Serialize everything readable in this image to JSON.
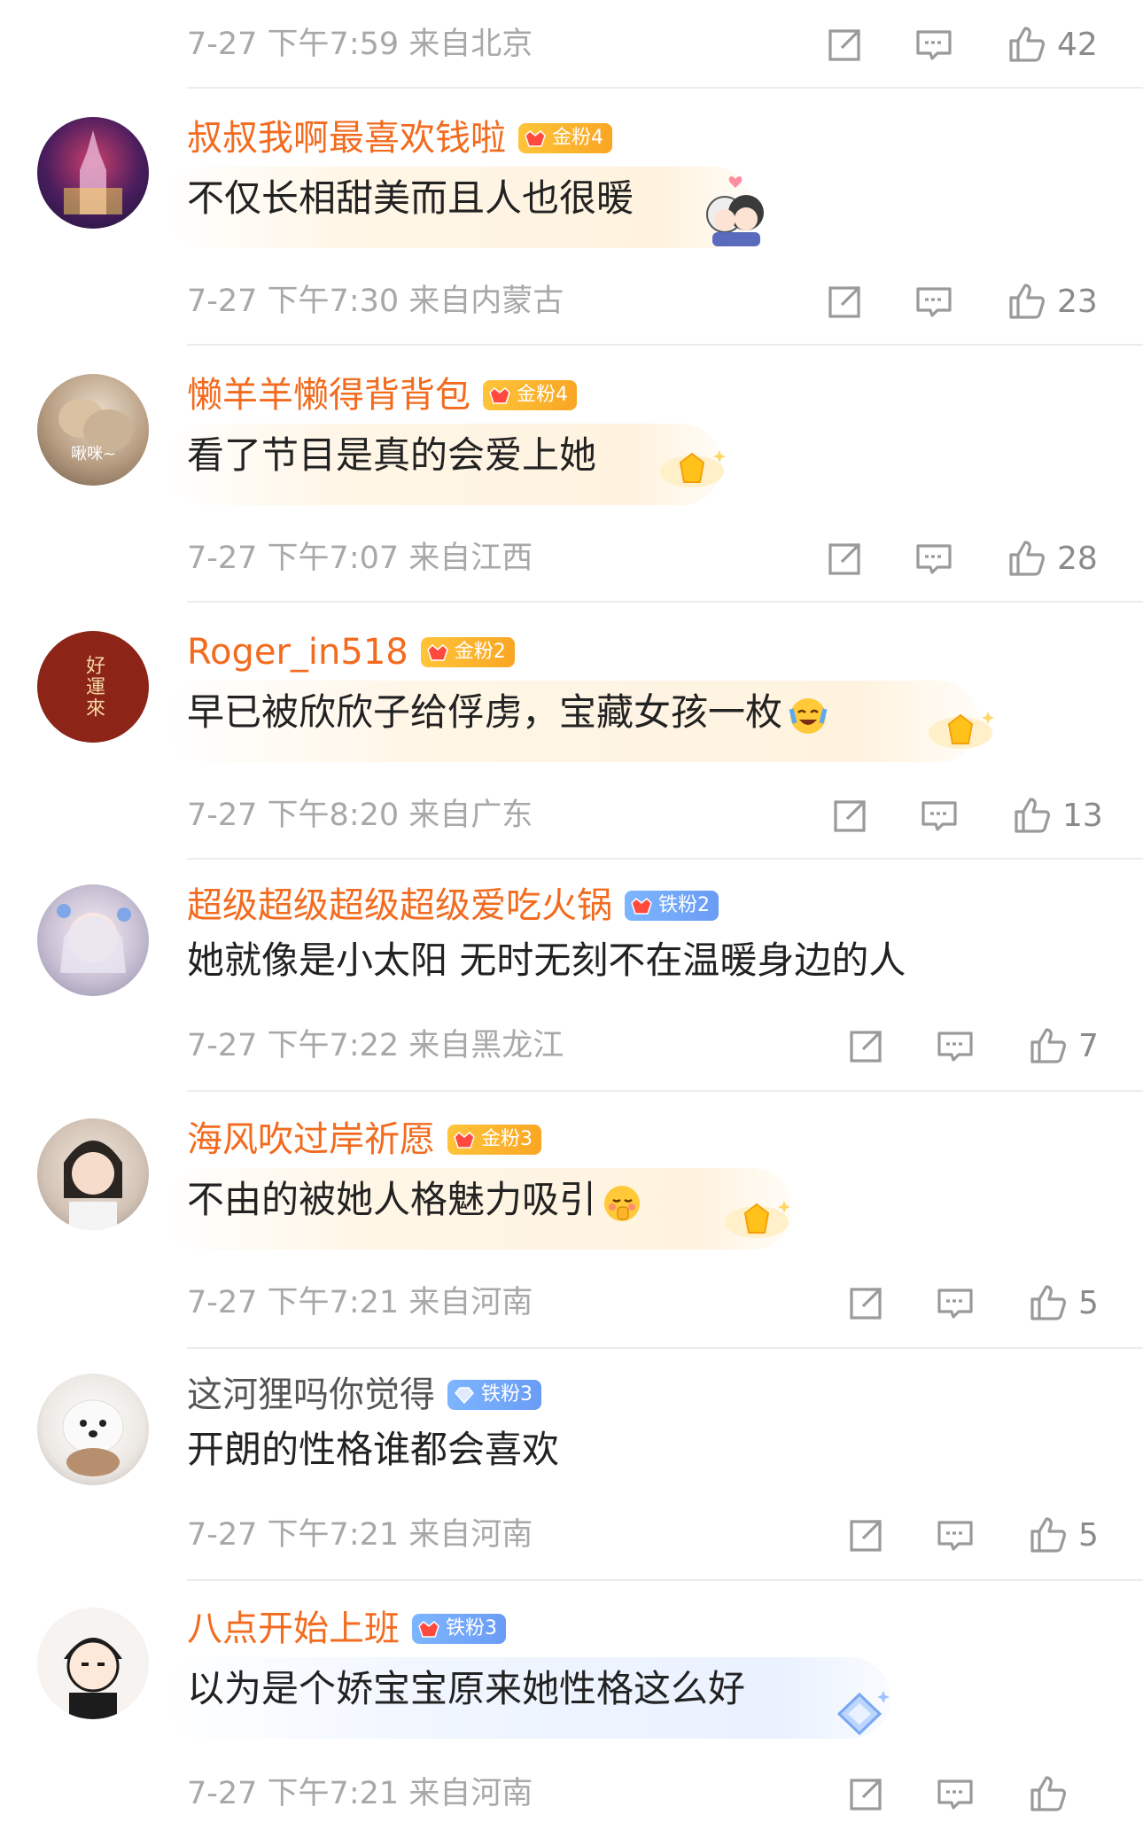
{
  "first_meta": {
    "time": "7-27 下午7:59 来自北京",
    "likes": "42"
  },
  "comments": [
    {
      "name": "叔叔我啊最喜欢钱啦",
      "badge": "金粉4",
      "text": "不仅长相甜美而且人也很暖",
      "time": "7-27 下午7:30 来自内蒙古",
      "likes": "23",
      "avatar_caption": ""
    },
    {
      "name": "懒羊羊懒得背背包",
      "badge": "金粉4",
      "text": "看了节目是真的会爱上她",
      "time": "7-27 下午7:07 来自江西",
      "likes": "28",
      "avatar_caption": "啾咪~"
    },
    {
      "name": "Roger_in518",
      "badge": "金粉2",
      "text": "早已被欣欣子给俘虏，宝藏女孩一枚",
      "time": "7-27 下午8:20 来自广东",
      "likes": "13",
      "avatar_caption": "好運來"
    },
    {
      "name": "超级超级超级超级爱吃火锅",
      "badge": "铁粉2",
      "text": "她就像是小太阳 无时无刻不在温暖身边的人",
      "time": "7-27 下午7:22 来自黑龙江",
      "likes": "7",
      "avatar_caption": ""
    },
    {
      "name": "海风吹过岸祈愿",
      "badge": "金粉3",
      "text": "不由的被她人格魅力吸引",
      "time": "7-27 下午7:21 来自河南",
      "likes": "5",
      "avatar_caption": ""
    },
    {
      "name": "这河狸吗你觉得",
      "badge": "铁粉3",
      "text": "开朗的性格谁都会喜欢",
      "time": "7-27 下午7:21 来自河南",
      "likes": "5",
      "avatar_caption": ""
    },
    {
      "name": "八点开始上班",
      "badge": "铁粉3",
      "text": "以为是个娇宝宝原来她性格这么好",
      "time": "7-27 下午7:21 来自河南",
      "likes": "",
      "avatar_caption": ""
    }
  ],
  "colors": {
    "name_orange": "#f26b1f",
    "gold_badge": "#f9a623",
    "iron_badge": "#6a9cf5",
    "meta_gray": "#a8a8a8",
    "divider": "#ececec"
  }
}
